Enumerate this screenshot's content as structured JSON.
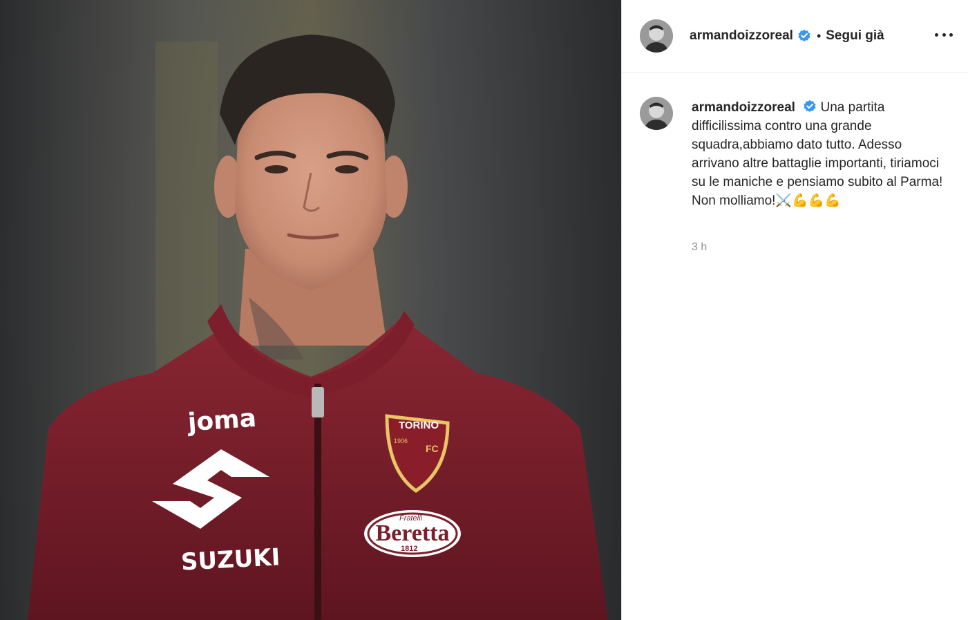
{
  "post": {
    "image_alt": "Player in Torino FC jacket",
    "jacket_texts": {
      "brand": "joma",
      "sponsor": "SUZUKI",
      "club_top": "TORINO",
      "club_year": "1906",
      "club_fc": "FC",
      "sponsor2_small": "Fratelli",
      "sponsor2": "Beretta",
      "sponsor2_year": "1812"
    }
  },
  "header": {
    "username": "armandoizzoreal",
    "separator": "•",
    "follow_label": "Segui già",
    "more_icon": "more-horizontal-icon"
  },
  "caption": {
    "username": "armandoizzoreal",
    "text": "Una partita difficilissima contro una grande squadra,abbiamo dato tutto. Adesso arrivano altre battaglie importanti, tiriamoci su le maniche e pensiamo subito al Parma! Non molliamo!⚔️💪💪💪",
    "timestamp": "3 h"
  },
  "colors": {
    "verified": "#3897f0",
    "jacket": "#7a1f2b",
    "text": "#262626",
    "muted": "#8e8e8e"
  }
}
